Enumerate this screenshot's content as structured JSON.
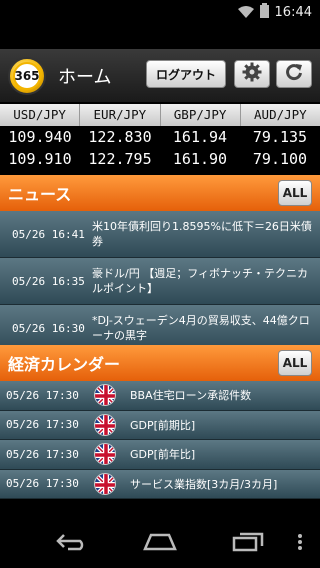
{
  "status": {
    "time": "16:44"
  },
  "header": {
    "logo_text": "365",
    "title": "ホーム",
    "logout_label": "ログアウト"
  },
  "rates": {
    "pairs": [
      "USD/JPY",
      "EUR/JPY",
      "GBP/JPY",
      "AUD/JPY"
    ],
    "bid": [
      "109.940",
      "122.830",
      "161.94",
      "79.135"
    ],
    "ask": [
      "109.910",
      "122.795",
      "161.90",
      "79.100"
    ]
  },
  "news": {
    "title": "ニュース",
    "all_label": "ALL",
    "items": [
      {
        "time": "05/26 16:41",
        "title": "米10年債利回り1.8595%に低下＝26日米債券"
      },
      {
        "time": "05/26 16:35",
        "title": "豪ドル/円 【週足；フィボナッチ・テクニカルポイント】"
      },
      {
        "time": "05/26 16:30",
        "title": "*DJ-スウェーデン4月の貿易収支、44億クローナの黒字"
      }
    ]
  },
  "calendar": {
    "title": "経済カレンダー",
    "all_label": "ALL",
    "items": [
      {
        "time": "05/26 17:30",
        "title": "BBA住宅ローン承認件数"
      },
      {
        "time": "05/26 17:30",
        "title": "GDP[前期比]"
      },
      {
        "time": "05/26 17:30",
        "title": "GDP[前年比]"
      },
      {
        "time": "05/26 17:30",
        "title": "サービス業指数[3カ月/3カ月]"
      }
    ]
  },
  "colors": {
    "accent_orange": "#f07a1e",
    "row_teal": "#3f5b67"
  },
  "icons": {
    "settings": "gear-icon",
    "refresh": "refresh-icon",
    "flag": "uk-flag-icon",
    "back": "back-icon",
    "home": "home-icon",
    "recents": "recents-icon",
    "menu": "overflow-menu-icon"
  }
}
